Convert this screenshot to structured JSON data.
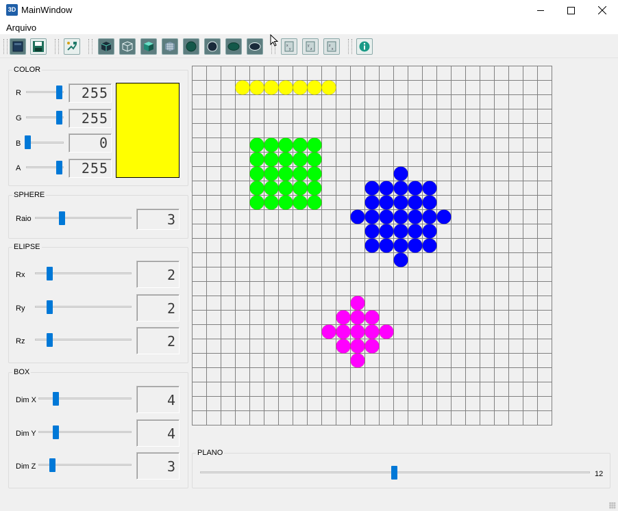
{
  "window": {
    "title": "MainWindow",
    "icon_name": "3d-app-icon",
    "icon_text": "3D"
  },
  "menu": {
    "items": [
      "Arquivo"
    ]
  },
  "toolbar": {
    "buttons": [
      "new-file-icon",
      "save-icon",
      "export-icon",
      "cube-solid-icon",
      "cube-wireframe-icon",
      "cube-shaded-icon",
      "cube-grid-icon",
      "sphere-solid-icon",
      "sphere-outline-icon",
      "ellipse-solid-icon",
      "ellipse-outline-icon",
      "view-xy-icon",
      "view-yz-icon",
      "view-zx-icon",
      "info-icon"
    ]
  },
  "color": {
    "title": "COLOR",
    "channels": [
      {
        "label": "R",
        "value": "255",
        "fraction": 1.0
      },
      {
        "label": "G",
        "value": "255",
        "fraction": 1.0
      },
      {
        "label": "B",
        "value": "0",
        "fraction": 0.0
      },
      {
        "label": "A",
        "value": "255",
        "fraction": 1.0
      }
    ],
    "swatch_color": "#ffff00"
  },
  "sphere": {
    "title": "SPHERE",
    "raio_label": "Raio",
    "raio_value": "3"
  },
  "ellipse": {
    "title": "ELIPSE",
    "rows": [
      {
        "label": "Rx",
        "value": "2"
      },
      {
        "label": "Ry",
        "value": "2"
      },
      {
        "label": "Rz",
        "value": "2"
      }
    ]
  },
  "box": {
    "title": "BOX",
    "rows": [
      {
        "label": "Dim X",
        "value": "4"
      },
      {
        "label": "Dim Y",
        "value": "4"
      },
      {
        "label": "Dim Z",
        "value": "3"
      }
    ]
  },
  "plano": {
    "title": "PLANO",
    "value": "12"
  },
  "grid": {
    "cols": 25,
    "rows": 25,
    "shapes": [
      {
        "color": "#ffff00",
        "cells": [
          [
            3,
            1
          ],
          [
            4,
            1
          ],
          [
            5,
            1
          ],
          [
            6,
            1
          ],
          [
            7,
            1
          ],
          [
            8,
            1
          ],
          [
            9,
            1
          ]
        ]
      },
      {
        "color": "#00ff00",
        "cells": [
          [
            4,
            5
          ],
          [
            5,
            5
          ],
          [
            6,
            5
          ],
          [
            7,
            5
          ],
          [
            8,
            5
          ],
          [
            4,
            6
          ],
          [
            5,
            6
          ],
          [
            6,
            6
          ],
          [
            7,
            6
          ],
          [
            8,
            6
          ],
          [
            4,
            7
          ],
          [
            5,
            7
          ],
          [
            6,
            7
          ],
          [
            7,
            7
          ],
          [
            8,
            7
          ],
          [
            4,
            8
          ],
          [
            5,
            8
          ],
          [
            6,
            8
          ],
          [
            7,
            8
          ],
          [
            8,
            8
          ],
          [
            4,
            9
          ],
          [
            5,
            9
          ],
          [
            6,
            9
          ],
          [
            7,
            9
          ],
          [
            8,
            9
          ]
        ]
      },
      {
        "color": "#0000ff",
        "cells": [
          [
            14,
            7
          ],
          [
            12,
            8
          ],
          [
            13,
            8
          ],
          [
            14,
            8
          ],
          [
            15,
            8
          ],
          [
            16,
            8
          ],
          [
            12,
            9
          ],
          [
            13,
            9
          ],
          [
            14,
            9
          ],
          [
            15,
            9
          ],
          [
            16,
            9
          ],
          [
            11,
            10
          ],
          [
            12,
            10
          ],
          [
            13,
            10
          ],
          [
            14,
            10
          ],
          [
            15,
            10
          ],
          [
            16,
            10
          ],
          [
            17,
            10
          ],
          [
            12,
            11
          ],
          [
            13,
            11
          ],
          [
            14,
            11
          ],
          [
            15,
            11
          ],
          [
            16,
            11
          ],
          [
            12,
            12
          ],
          [
            13,
            12
          ],
          [
            14,
            12
          ],
          [
            15,
            12
          ],
          [
            16,
            12
          ],
          [
            14,
            13
          ]
        ]
      },
      {
        "color": "#ff00ff",
        "cells": [
          [
            11,
            16
          ],
          [
            10,
            17
          ],
          [
            11,
            17
          ],
          [
            12,
            17
          ],
          [
            9,
            18
          ],
          [
            10,
            18
          ],
          [
            11,
            18
          ],
          [
            12,
            18
          ],
          [
            13,
            18
          ],
          [
            10,
            19
          ],
          [
            11,
            19
          ],
          [
            12,
            19
          ],
          [
            11,
            20
          ]
        ]
      }
    ]
  }
}
